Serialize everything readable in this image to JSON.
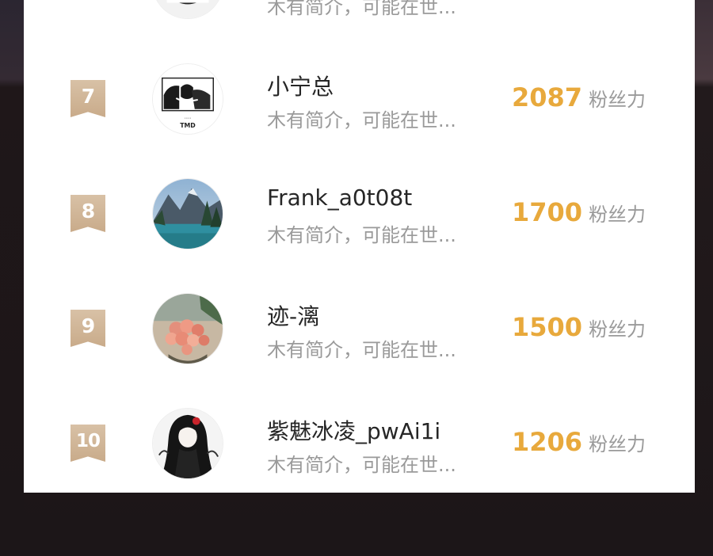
{
  "ranking": {
    "partial_top": {
      "intro": "木有简介，可能在世..."
    },
    "rows": [
      {
        "rank": "7",
        "name": "小宁总",
        "intro": "木有简介，可能在世...",
        "fans_count": "2087",
        "fans_label": "粉丝力",
        "avatar": "avatar-sketch",
        "avatar_text": "TMD"
      },
      {
        "rank": "8",
        "name": "Frank_a0t08t",
        "intro": "木有简介，可能在世...",
        "fans_count": "1700",
        "fans_label": "粉丝力",
        "avatar": "avatar-lake"
      },
      {
        "rank": "9",
        "name": "迹-漓",
        "intro": "木有简介，可能在世...",
        "fans_count": "1500",
        "fans_label": "粉丝力",
        "avatar": "avatar-flowers"
      },
      {
        "rank": "10",
        "name": "紫魅冰凌_pwAi1i",
        "intro": "木有简介，可能在世...",
        "fans_count": "1206",
        "fans_label": "粉丝力",
        "avatar": "avatar-anime"
      }
    ]
  },
  "colors": {
    "fans_count": "#e8a93c",
    "badge": "#d2b89b",
    "name": "#262626",
    "secondary": "#9a9a9a"
  }
}
